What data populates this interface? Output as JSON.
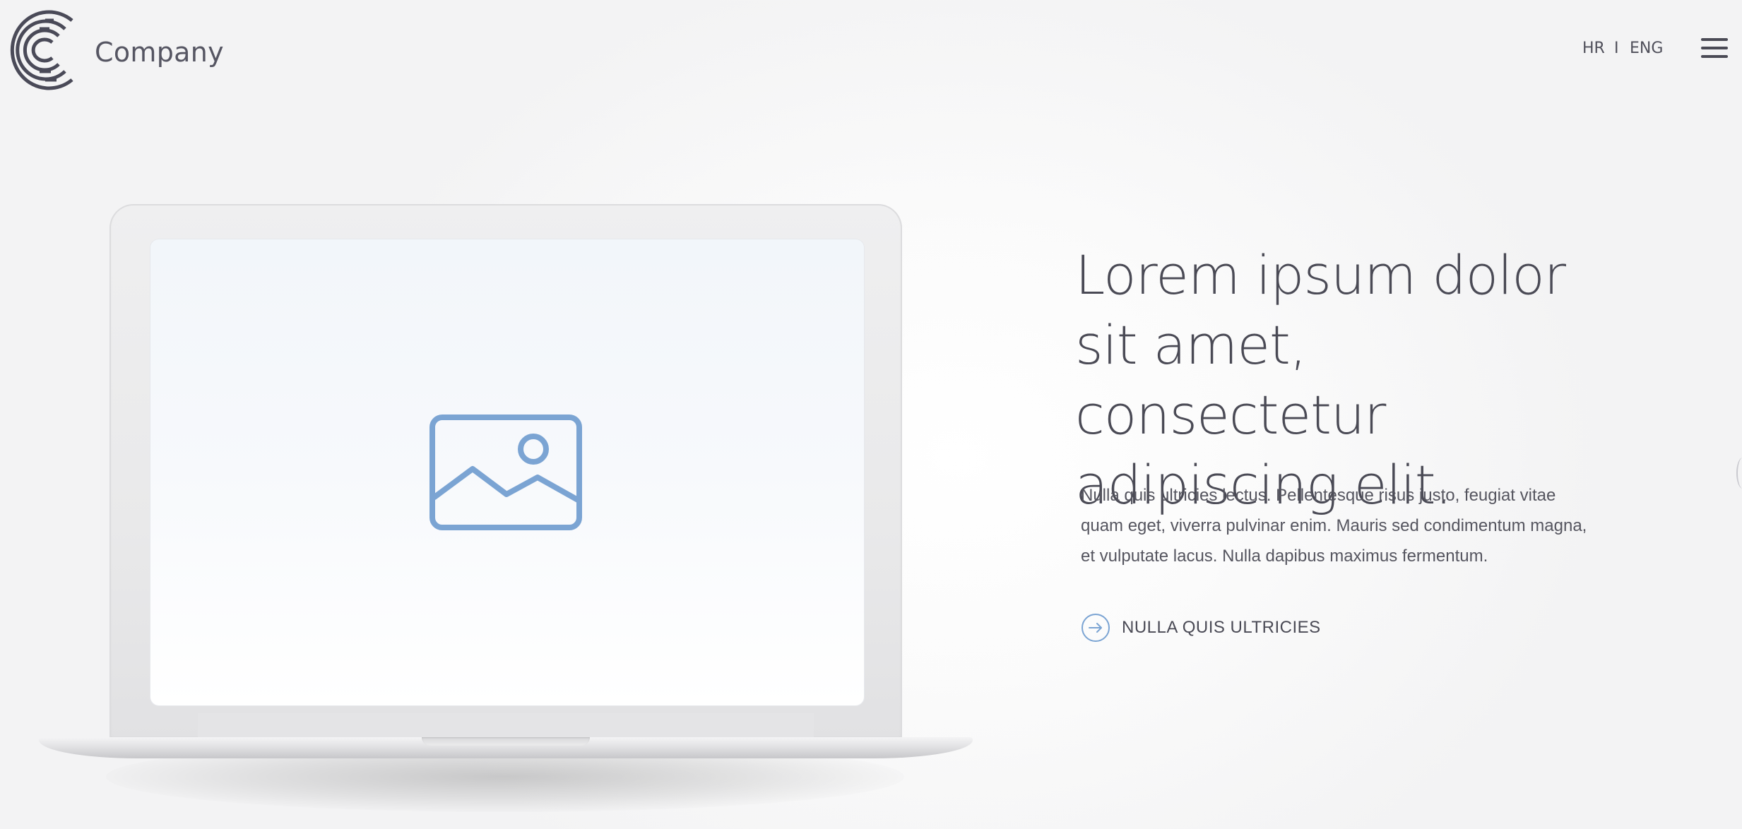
{
  "header": {
    "company_name": "Company",
    "logo_icon": "company-c-logo-icon",
    "lang_hr": "HR",
    "lang_separator": "I",
    "lang_eng": "ENG",
    "menu_icon": "hamburger-menu-icon"
  },
  "hero": {
    "title": "Lorem ipsum dolor sit amet, consectetur adipiscing elit.",
    "text": "Nulla quis ultricies lectus. Pellentesque risus justo, feugiat vitae quam eget, viverra pulvinar enim. Mauris sed condimentum magna, et vulputate lacus. Nulla dapibus maximus fermentum.",
    "cta_label": "NULLA QUIS ULTRICIES",
    "cta_icon": "arrow-right-circle-icon"
  },
  "laptop": {
    "screen_icon": "image-placeholder-icon"
  },
  "colors": {
    "text": "#4a4a55",
    "accent": "#7ba4d3",
    "logo": "#4a4a58"
  }
}
